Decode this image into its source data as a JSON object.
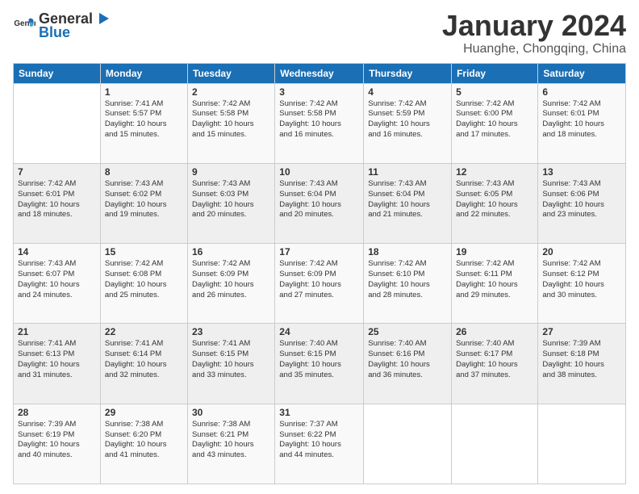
{
  "logo": {
    "general": "General",
    "blue": "Blue"
  },
  "title": "January 2024",
  "location": "Huanghe, Chongqing, China",
  "headers": [
    "Sunday",
    "Monday",
    "Tuesday",
    "Wednesday",
    "Thursday",
    "Friday",
    "Saturday"
  ],
  "rows": [
    [
      {
        "day": "",
        "sunrise": "",
        "sunset": "",
        "daylight": ""
      },
      {
        "day": "1",
        "sunrise": "Sunrise: 7:41 AM",
        "sunset": "Sunset: 5:57 PM",
        "daylight": "Daylight: 10 hours and 15 minutes."
      },
      {
        "day": "2",
        "sunrise": "Sunrise: 7:42 AM",
        "sunset": "Sunset: 5:58 PM",
        "daylight": "Daylight: 10 hours and 15 minutes."
      },
      {
        "day": "3",
        "sunrise": "Sunrise: 7:42 AM",
        "sunset": "Sunset: 5:58 PM",
        "daylight": "Daylight: 10 hours and 16 minutes."
      },
      {
        "day": "4",
        "sunrise": "Sunrise: 7:42 AM",
        "sunset": "Sunset: 5:59 PM",
        "daylight": "Daylight: 10 hours and 16 minutes."
      },
      {
        "day": "5",
        "sunrise": "Sunrise: 7:42 AM",
        "sunset": "Sunset: 6:00 PM",
        "daylight": "Daylight: 10 hours and 17 minutes."
      },
      {
        "day": "6",
        "sunrise": "Sunrise: 7:42 AM",
        "sunset": "Sunset: 6:01 PM",
        "daylight": "Daylight: 10 hours and 18 minutes."
      }
    ],
    [
      {
        "day": "7",
        "sunrise": "Sunrise: 7:42 AM",
        "sunset": "Sunset: 6:01 PM",
        "daylight": "Daylight: 10 hours and 18 minutes."
      },
      {
        "day": "8",
        "sunrise": "Sunrise: 7:43 AM",
        "sunset": "Sunset: 6:02 PM",
        "daylight": "Daylight: 10 hours and 19 minutes."
      },
      {
        "day": "9",
        "sunrise": "Sunrise: 7:43 AM",
        "sunset": "Sunset: 6:03 PM",
        "daylight": "Daylight: 10 hours and 20 minutes."
      },
      {
        "day": "10",
        "sunrise": "Sunrise: 7:43 AM",
        "sunset": "Sunset: 6:04 PM",
        "daylight": "Daylight: 10 hours and 20 minutes."
      },
      {
        "day": "11",
        "sunrise": "Sunrise: 7:43 AM",
        "sunset": "Sunset: 6:04 PM",
        "daylight": "Daylight: 10 hours and 21 minutes."
      },
      {
        "day": "12",
        "sunrise": "Sunrise: 7:43 AM",
        "sunset": "Sunset: 6:05 PM",
        "daylight": "Daylight: 10 hours and 22 minutes."
      },
      {
        "day": "13",
        "sunrise": "Sunrise: 7:43 AM",
        "sunset": "Sunset: 6:06 PM",
        "daylight": "Daylight: 10 hours and 23 minutes."
      }
    ],
    [
      {
        "day": "14",
        "sunrise": "Sunrise: 7:43 AM",
        "sunset": "Sunset: 6:07 PM",
        "daylight": "Daylight: 10 hours and 24 minutes."
      },
      {
        "day": "15",
        "sunrise": "Sunrise: 7:42 AM",
        "sunset": "Sunset: 6:08 PM",
        "daylight": "Daylight: 10 hours and 25 minutes."
      },
      {
        "day": "16",
        "sunrise": "Sunrise: 7:42 AM",
        "sunset": "Sunset: 6:09 PM",
        "daylight": "Daylight: 10 hours and 26 minutes."
      },
      {
        "day": "17",
        "sunrise": "Sunrise: 7:42 AM",
        "sunset": "Sunset: 6:09 PM",
        "daylight": "Daylight: 10 hours and 27 minutes."
      },
      {
        "day": "18",
        "sunrise": "Sunrise: 7:42 AM",
        "sunset": "Sunset: 6:10 PM",
        "daylight": "Daylight: 10 hours and 28 minutes."
      },
      {
        "day": "19",
        "sunrise": "Sunrise: 7:42 AM",
        "sunset": "Sunset: 6:11 PM",
        "daylight": "Daylight: 10 hours and 29 minutes."
      },
      {
        "day": "20",
        "sunrise": "Sunrise: 7:42 AM",
        "sunset": "Sunset: 6:12 PM",
        "daylight": "Daylight: 10 hours and 30 minutes."
      }
    ],
    [
      {
        "day": "21",
        "sunrise": "Sunrise: 7:41 AM",
        "sunset": "Sunset: 6:13 PM",
        "daylight": "Daylight: 10 hours and 31 minutes."
      },
      {
        "day": "22",
        "sunrise": "Sunrise: 7:41 AM",
        "sunset": "Sunset: 6:14 PM",
        "daylight": "Daylight: 10 hours and 32 minutes."
      },
      {
        "day": "23",
        "sunrise": "Sunrise: 7:41 AM",
        "sunset": "Sunset: 6:15 PM",
        "daylight": "Daylight: 10 hours and 33 minutes."
      },
      {
        "day": "24",
        "sunrise": "Sunrise: 7:40 AM",
        "sunset": "Sunset: 6:15 PM",
        "daylight": "Daylight: 10 hours and 35 minutes."
      },
      {
        "day": "25",
        "sunrise": "Sunrise: 7:40 AM",
        "sunset": "Sunset: 6:16 PM",
        "daylight": "Daylight: 10 hours and 36 minutes."
      },
      {
        "day": "26",
        "sunrise": "Sunrise: 7:40 AM",
        "sunset": "Sunset: 6:17 PM",
        "daylight": "Daylight: 10 hours and 37 minutes."
      },
      {
        "day": "27",
        "sunrise": "Sunrise: 7:39 AM",
        "sunset": "Sunset: 6:18 PM",
        "daylight": "Daylight: 10 hours and 38 minutes."
      }
    ],
    [
      {
        "day": "28",
        "sunrise": "Sunrise: 7:39 AM",
        "sunset": "Sunset: 6:19 PM",
        "daylight": "Daylight: 10 hours and 40 minutes."
      },
      {
        "day": "29",
        "sunrise": "Sunrise: 7:38 AM",
        "sunset": "Sunset: 6:20 PM",
        "daylight": "Daylight: 10 hours and 41 minutes."
      },
      {
        "day": "30",
        "sunrise": "Sunrise: 7:38 AM",
        "sunset": "Sunset: 6:21 PM",
        "daylight": "Daylight: 10 hours and 43 minutes."
      },
      {
        "day": "31",
        "sunrise": "Sunrise: 7:37 AM",
        "sunset": "Sunset: 6:22 PM",
        "daylight": "Daylight: 10 hours and 44 minutes."
      },
      {
        "day": "",
        "sunrise": "",
        "sunset": "",
        "daylight": ""
      },
      {
        "day": "",
        "sunrise": "",
        "sunset": "",
        "daylight": ""
      },
      {
        "day": "",
        "sunrise": "",
        "sunset": "",
        "daylight": ""
      }
    ]
  ]
}
